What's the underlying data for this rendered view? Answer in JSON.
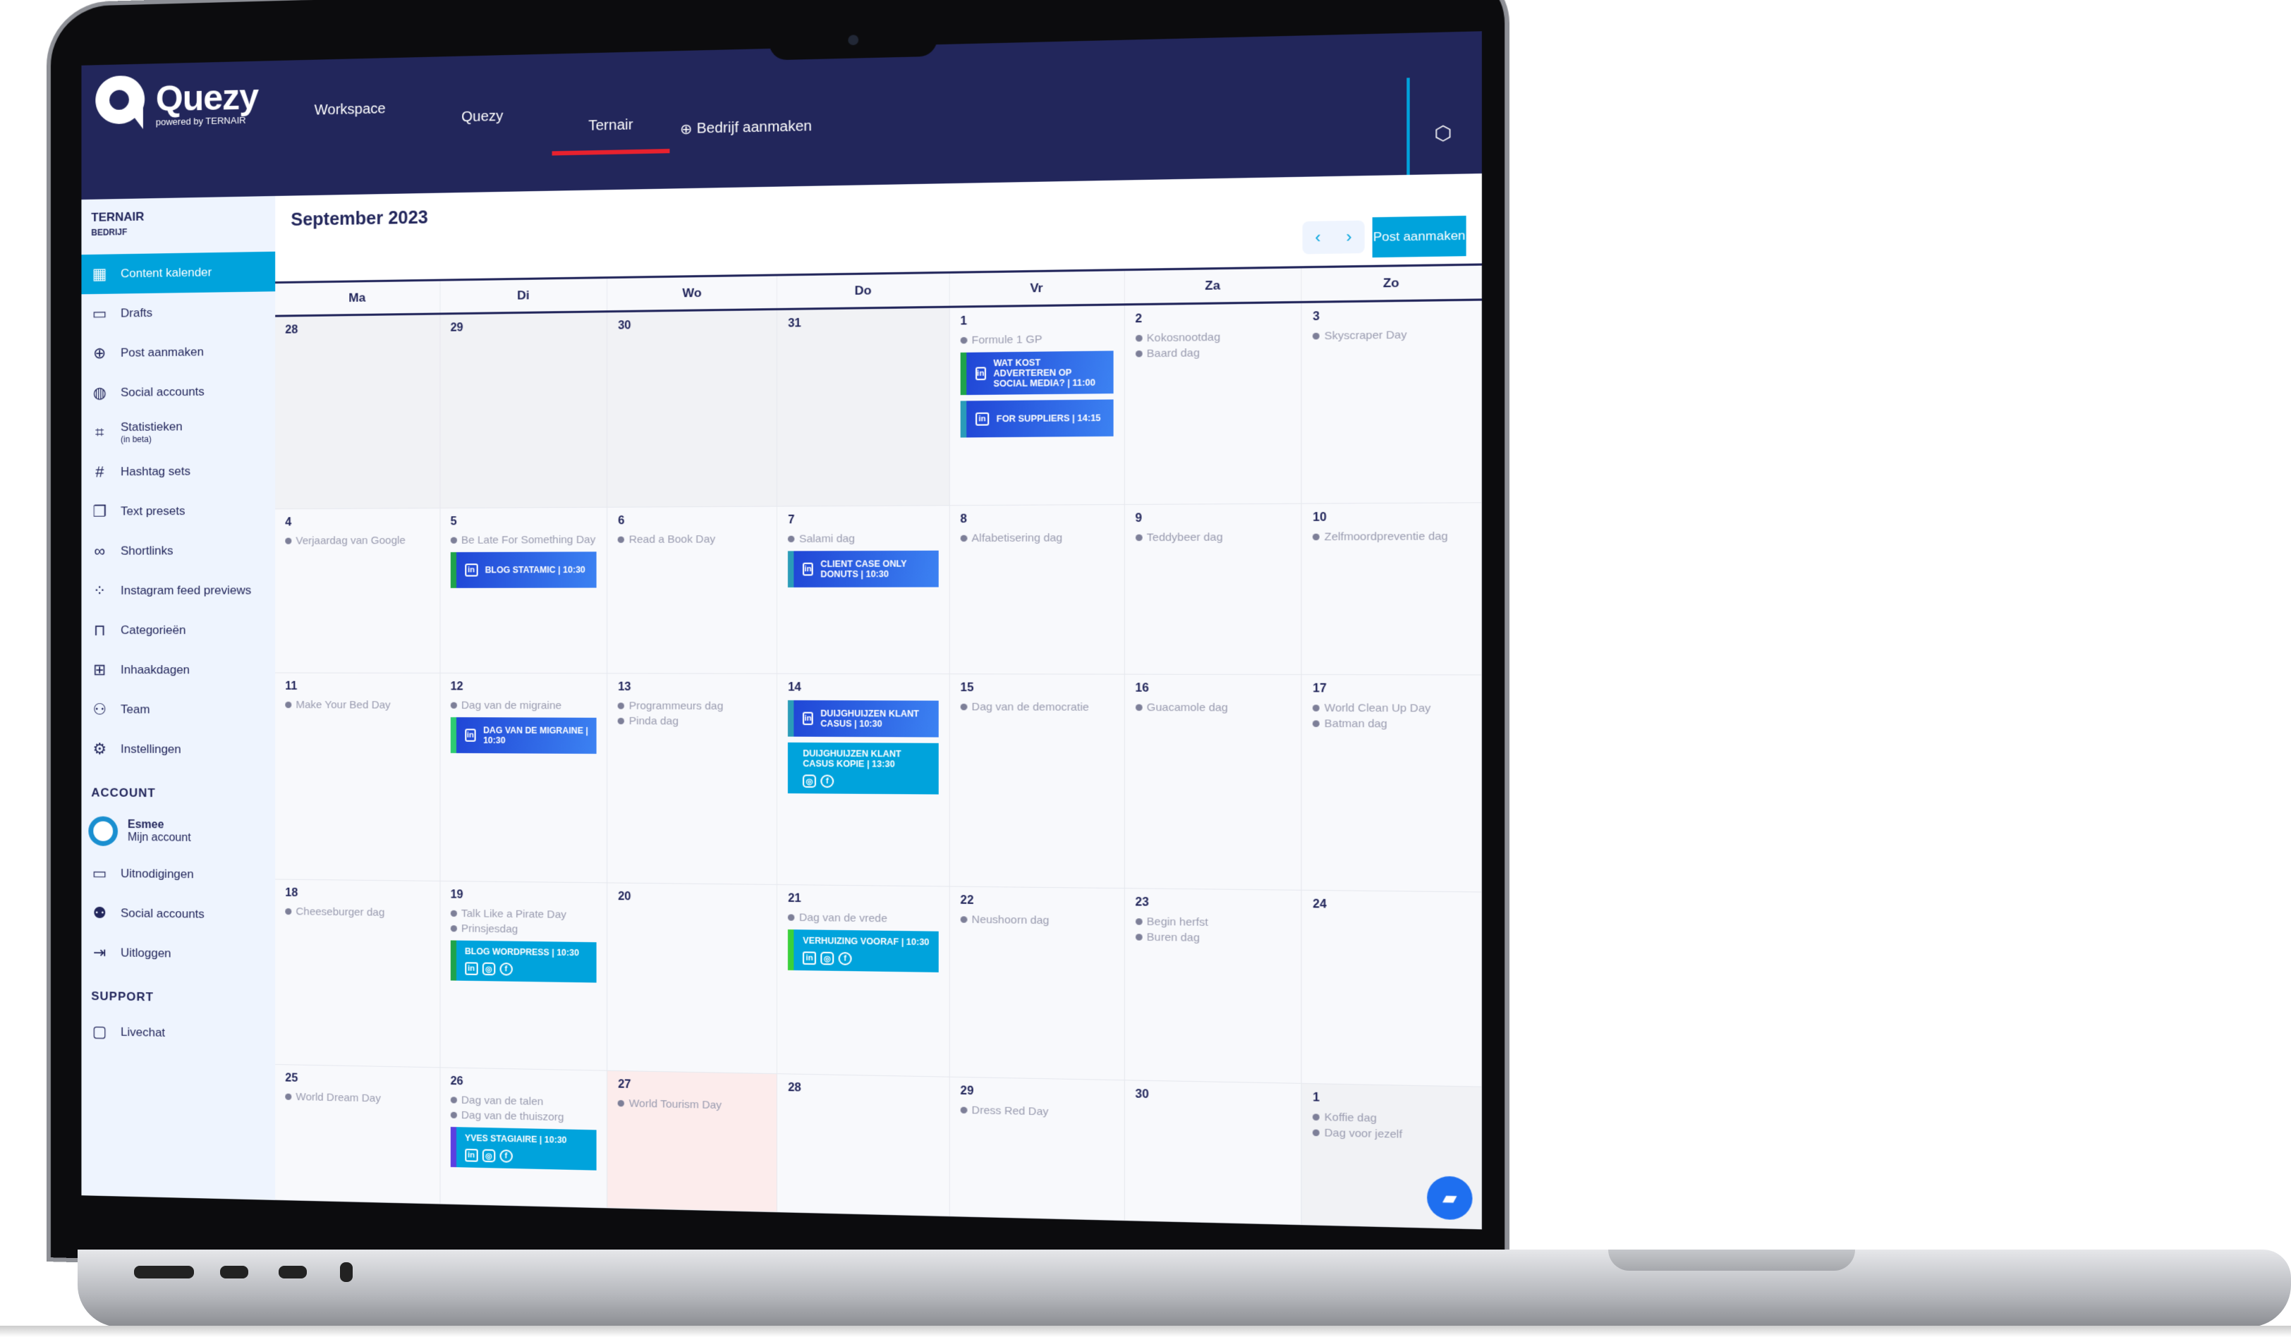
{
  "app": {
    "name": "Quezy",
    "tagline": "powered by TERNAIR"
  },
  "nav": {
    "tabs": [
      {
        "label": "Workspace"
      },
      {
        "label": "Quezy"
      },
      {
        "label": "Ternair",
        "active": true
      }
    ],
    "create_label": "Bedrijf aanmaken"
  },
  "sidebar": {
    "org_name": "TERNAIR",
    "org_type": "BEDRIJF",
    "items": [
      {
        "label": "Content kalender",
        "icon": "calendar-icon",
        "active": true
      },
      {
        "label": "Drafts",
        "icon": "archive-icon"
      },
      {
        "label": "Post aanmaken",
        "icon": "plus-circle-icon"
      },
      {
        "label": "Social accounts",
        "icon": "globe-icon"
      },
      {
        "label": "Statistieken",
        "sub": "(in beta)",
        "icon": "chart-icon"
      },
      {
        "label": "Hashtag sets",
        "icon": "hashtag-icon"
      },
      {
        "label": "Text presets",
        "icon": "copy-icon"
      },
      {
        "label": "Shortlinks",
        "icon": "link-icon"
      },
      {
        "label": "Instagram feed previews",
        "icon": "grid-icon"
      },
      {
        "label": "Categorieën",
        "icon": "tray-icon"
      },
      {
        "label": "Inhaakdagen",
        "icon": "book-icon"
      },
      {
        "label": "Team",
        "icon": "users-icon"
      },
      {
        "label": "Instellingen",
        "icon": "gear-icon"
      }
    ],
    "account_heading": "ACCOUNT",
    "user": {
      "name": "Esmee",
      "sub": "Mijn account"
    },
    "account_items": [
      {
        "label": "Uitnodigingen",
        "icon": "archive-icon"
      },
      {
        "label": "Social accounts",
        "icon": "group-icon"
      },
      {
        "label": "Uitloggen",
        "icon": "logout-icon"
      }
    ],
    "support_heading": "SUPPORT",
    "support_items": [
      {
        "label": "Livechat",
        "icon": "chat-icon"
      }
    ]
  },
  "calendar": {
    "month": "September 2023",
    "post_button": "Post aanmaken",
    "weekdays": [
      "Ma",
      "Di",
      "Wo",
      "Do",
      "Vr",
      "Za",
      "Zo"
    ],
    "colors": {
      "blue": "#2046d6",
      "cyan": "#00a3dc",
      "green": "#1fa34a",
      "teal": "#2a9cb8",
      "lime": "#3ad13a",
      "purple": "#5b3fe0",
      "mint": "#2ecc71"
    },
    "days": [
      {
        "n": "28",
        "muted": true
      },
      {
        "n": "29",
        "muted": true
      },
      {
        "n": "30",
        "muted": true
      },
      {
        "n": "31",
        "muted": true
      },
      {
        "n": "1",
        "holidays": [
          "Formule 1 GP"
        ],
        "posts": [
          {
            "title": "WAT KOST ADVERTEREN OP SOCIAL MEDIA?",
            "time": "11:00",
            "style": "blue",
            "border": "green",
            "icons": [
              "linkedin"
            ]
          },
          {
            "title": "FOR SUPPLIERS",
            "time": "14:15",
            "style": "blue",
            "border": "teal",
            "icons": [
              "linkedin"
            ]
          }
        ]
      },
      {
        "n": "2",
        "holidays": [
          "Kokosnootdag",
          "Baard dag"
        ]
      },
      {
        "n": "3",
        "holidays": [
          "Skyscraper Day"
        ]
      },
      {
        "n": "4",
        "holidays": [
          "Verjaardag van Google"
        ]
      },
      {
        "n": "5",
        "holidays": [
          "Be Late For Something Day"
        ],
        "posts": [
          {
            "title": "BLOG STATAMIC",
            "time": "10:30",
            "style": "blue",
            "border": "green",
            "icons": [
              "linkedin"
            ]
          }
        ]
      },
      {
        "n": "6",
        "holidays": [
          "Read a Book Day"
        ]
      },
      {
        "n": "7",
        "holidays": [
          "Salami dag"
        ],
        "posts": [
          {
            "title": "CLIENT CASE ONLY DONUTS",
            "time": "10:30",
            "style": "blue",
            "border": "teal",
            "icons": [
              "linkedin"
            ]
          }
        ]
      },
      {
        "n": "8",
        "holidays": [
          "Alfabetisering dag"
        ]
      },
      {
        "n": "9",
        "holidays": [
          "Teddybeer dag"
        ]
      },
      {
        "n": "10",
        "holidays": [
          "Zelfmoordpreventie dag"
        ]
      },
      {
        "n": "11",
        "holidays": [
          "Make Your Bed Day"
        ]
      },
      {
        "n": "12",
        "holidays": [
          "Dag van de migraine"
        ],
        "posts": [
          {
            "title": "DAG VAN DE MIGRAINE",
            "time": "10:30",
            "style": "blue",
            "border": "mint",
            "icons": [
              "linkedin"
            ]
          }
        ]
      },
      {
        "n": "13",
        "holidays": [
          "Programmeurs dag",
          "Pinda dag"
        ]
      },
      {
        "n": "14",
        "posts": [
          {
            "title": "DUIJGHUIJZEN KLANT CASUS",
            "time": "10:30",
            "style": "blue",
            "border": "teal",
            "icons": [
              "linkedin"
            ]
          },
          {
            "title": "DUIJGHUIJZEN KLANT CASUS KOPIE",
            "time": "13:30",
            "style": "cyan",
            "icons": [
              "instagram",
              "facebook"
            ]
          }
        ]
      },
      {
        "n": "15",
        "holidays": [
          "Dag van de democratie"
        ]
      },
      {
        "n": "16",
        "holidays": [
          "Guacamole dag"
        ]
      },
      {
        "n": "17",
        "holidays": [
          "World Clean Up Day",
          "Batman dag"
        ]
      },
      {
        "n": "18",
        "holidays": [
          "Cheeseburger dag"
        ]
      },
      {
        "n": "19",
        "holidays": [
          "Talk Like a Pirate Day",
          "Prinsjesdag"
        ],
        "posts": [
          {
            "title": "BLOG WORDPRESS",
            "time": "10:30",
            "style": "cyan",
            "border": "green",
            "icons": [
              "linkedin",
              "instagram",
              "facebook"
            ]
          }
        ]
      },
      {
        "n": "20"
      },
      {
        "n": "21",
        "holidays": [
          "Dag van de vrede"
        ],
        "posts": [
          {
            "title": "VERHUIZING VOORAF",
            "time": "10:30",
            "style": "cyan",
            "border": "lime",
            "icons": [
              "linkedin",
              "instagram",
              "facebook"
            ]
          }
        ]
      },
      {
        "n": "22",
        "holidays": [
          "Neushoorn dag"
        ]
      },
      {
        "n": "23",
        "holidays": [
          "Begin herfst",
          "Buren dag"
        ]
      },
      {
        "n": "24"
      },
      {
        "n": "25",
        "holidays": [
          "World Dream Day"
        ]
      },
      {
        "n": "26",
        "holidays": [
          "Dag van de talen",
          "Dag van de thuiszorg"
        ],
        "posts": [
          {
            "title": "YVES STAGIAIRE",
            "time": "10:30",
            "style": "cyan",
            "border": "purple",
            "icons": [
              "linkedin",
              "instagram",
              "facebook"
            ]
          }
        ]
      },
      {
        "n": "27",
        "holidays": [
          "World Tourism Day"
        ],
        "today": true
      },
      {
        "n": "28"
      },
      {
        "n": "29",
        "holidays": [
          "Dress Red Day"
        ]
      },
      {
        "n": "30"
      },
      {
        "n": "1",
        "muted": true,
        "holidays": [
          "Koffie dag",
          "Dag voor jezelf"
        ]
      }
    ]
  }
}
